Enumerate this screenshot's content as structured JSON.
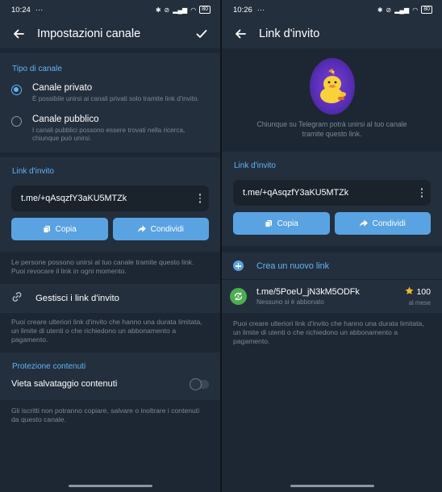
{
  "left": {
    "status": {
      "time": "10:24",
      "dots": "···",
      "battery": "80"
    },
    "appbar": {
      "title": "Impostazioni canale"
    },
    "channel_type": {
      "section_title": "Tipo di canale",
      "options": [
        {
          "label": "Canale privato",
          "desc": "È possibile unirsi ai canali privati solo tramite link d'invito.",
          "selected": true
        },
        {
          "label": "Canale pubblico",
          "desc": "I canali pubblici possono essere trovati nella ricerca, chiunque può unirsi.",
          "selected": false
        }
      ]
    },
    "invite": {
      "section_title": "Link d'invito",
      "link": "t.me/+qAsqzfY3aKU5MTZk",
      "copy_label": "Copia",
      "share_label": "Condividi",
      "hint": "Le persone possono unirsi al tuo canale tramite questo link. Puoi revocare il link in ogni momento."
    },
    "manage": {
      "label": "Gestisci i link d'invito",
      "hint": "Puoi creare ulteriori link d'invito che hanno una durata limitata, un limite di utenti o che richiedono un abbonamento a pagamento."
    },
    "protection": {
      "section_title": "Protezione contenuti",
      "toggle_label": "Vieta salvataggio contenuti",
      "hint": "Gli iscritti non potranno copiare, salvare o inoltrare i contenuti da questo canale."
    }
  },
  "right": {
    "status": {
      "time": "10:26",
      "dots": "···",
      "battery": "80"
    },
    "appbar": {
      "title": "Link d'invito"
    },
    "hero_text": "Chiunque su Telegram potrà unirsi al tuo canale tramite questo link.",
    "invite": {
      "section_title": "Link d'invito",
      "link": "t.me/+qAsqzfY3aKU5MTZk",
      "copy_label": "Copia",
      "share_label": "Condividi"
    },
    "create_label": "Crea un nuovo link",
    "links": [
      {
        "name": "t.me/5PoeU_jN3kM5ODFk",
        "sub": "Nessuno si è abbonato",
        "amount": "100",
        "period": "al mese"
      }
    ],
    "hint": "Puoi creare ulteriori link d'invito che hanno una durata limitata, un limite di utenti o che richiedono un abbonamento a pagamento."
  },
  "colors": {
    "accent": "#5eb5f7",
    "button": "#5aa3e2",
    "surface": "#242f3d",
    "background": "#1d2733",
    "star": "#f5b728",
    "subscription_icon": "#4cae4f"
  }
}
